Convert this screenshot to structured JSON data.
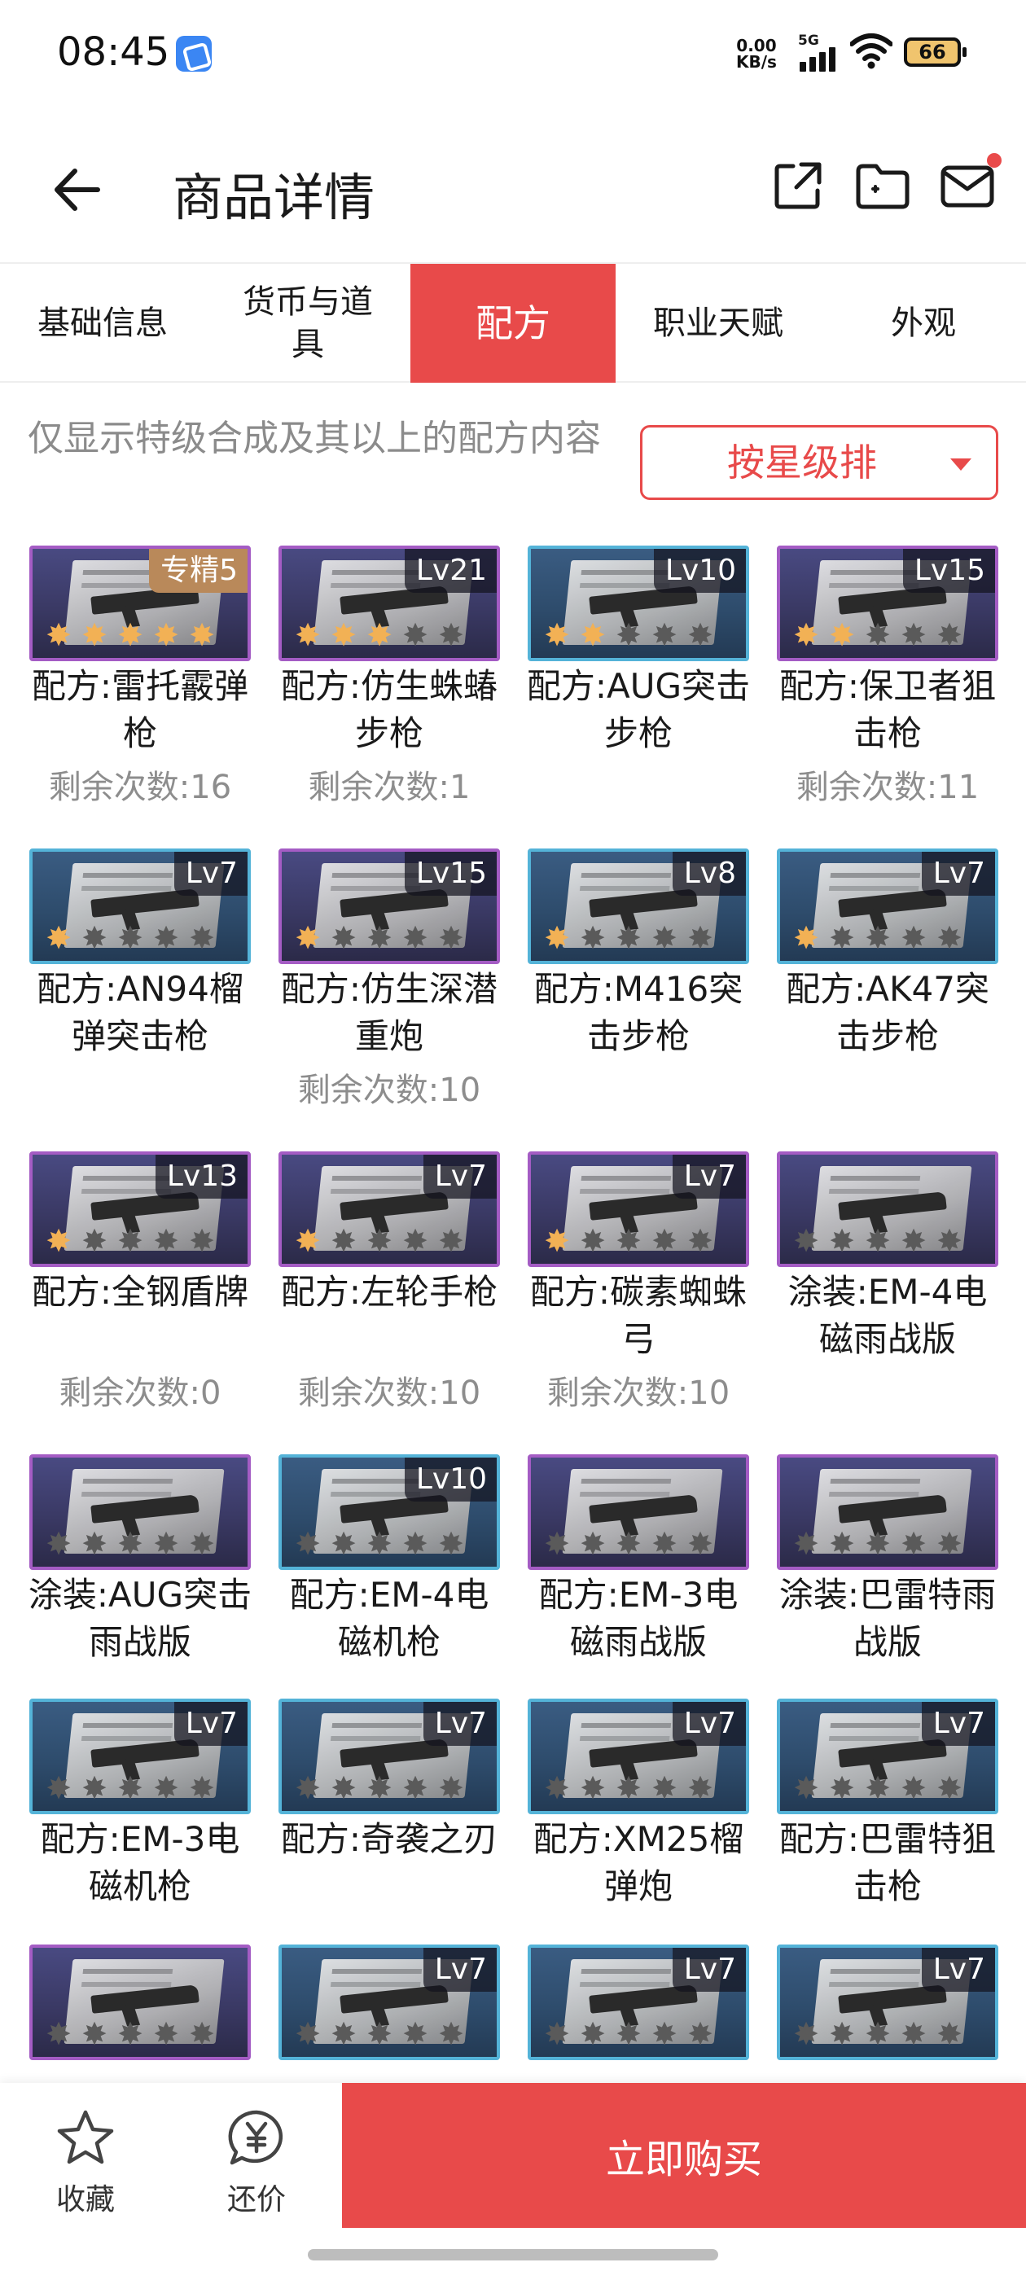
{
  "status_bar": {
    "time": "08:45",
    "net_speed_value": "0.00",
    "net_speed_unit": "KB/s",
    "network": "5G",
    "battery": "66"
  },
  "header": {
    "title": "商品详情",
    "back_icon": "arrow-left-icon",
    "icons": [
      "share-icon",
      "folder-icon",
      "mail-icon"
    ]
  },
  "tabs": [
    {
      "label": "基础信息",
      "active": false
    },
    {
      "label": "货币与道具",
      "active": false
    },
    {
      "label": "配方",
      "active": true
    },
    {
      "label": "职业天赋",
      "active": false
    },
    {
      "label": "外观",
      "active": false
    }
  ],
  "filter": {
    "notice": "仅显示特级合成及其以上的配方内容",
    "sort_label": "按星级排"
  },
  "items": [
    {
      "name": "配方:雷托霰弹枪",
      "badge": "专精5",
      "count": "剩余次数:16",
      "stars": 5,
      "frame": "purple"
    },
    {
      "name": "配方:仿生蛛蝽步枪",
      "badge": "Lv21",
      "count": "剩余次数:1",
      "stars": 3,
      "frame": "purple"
    },
    {
      "name": "配方:AUG突击步枪",
      "badge": "Lv10",
      "count": "",
      "stars": 2,
      "frame": "blue"
    },
    {
      "name": "配方:保卫者狙击枪",
      "badge": "Lv15",
      "count": "剩余次数:11",
      "stars": 2,
      "frame": "purple"
    },
    {
      "name": "配方:AN94榴弹突击枪",
      "badge": "Lv7",
      "count": "",
      "stars": 1,
      "frame": "blue"
    },
    {
      "name": "配方:仿生深潜重炮",
      "badge": "Lv15",
      "count": "剩余次数:10",
      "stars": 1,
      "frame": "purple"
    },
    {
      "name": "配方:M416突击步枪",
      "badge": "Lv8",
      "count": "",
      "stars": 1,
      "frame": "blue"
    },
    {
      "name": "配方:AK47突击步枪",
      "badge": "Lv7",
      "count": "",
      "stars": 1,
      "frame": "blue"
    },
    {
      "name": "配方:全钢盾牌",
      "badge": "Lv13",
      "count": "剩余次数:0",
      "stars": 1,
      "frame": "purple"
    },
    {
      "name": "配方:左轮手枪",
      "badge": "Lv7",
      "count": "剩余次数:10",
      "stars": 1,
      "frame": "purple"
    },
    {
      "name": "配方:碳素蜘蛛弓",
      "badge": "Lv7",
      "count": "剩余次数:10",
      "stars": 1,
      "frame": "purple"
    },
    {
      "name": "涂装:EM-4电磁雨战版",
      "badge": "",
      "count": "",
      "stars": 0,
      "frame": "purple"
    },
    {
      "name": "涂装:AUG突击雨战版",
      "badge": "",
      "count": "",
      "stars": 0,
      "frame": "purple"
    },
    {
      "name": "配方:EM-4电磁机枪",
      "badge": "Lv10",
      "count": "",
      "stars": 0,
      "frame": "blue"
    },
    {
      "name": "配方:EM-3电磁雨战版",
      "badge": "",
      "count": "",
      "stars": 0,
      "frame": "purple"
    },
    {
      "name": "涂装:巴雷特雨战版",
      "badge": "",
      "count": "",
      "stars": 0,
      "frame": "purple"
    },
    {
      "name": "配方:EM-3电磁机枪",
      "badge": "Lv7",
      "count": "",
      "stars": 0,
      "frame": "blue"
    },
    {
      "name": "配方:奇袭之刃",
      "badge": "Lv7",
      "count": "",
      "stars": 0,
      "frame": "blue"
    },
    {
      "name": "配方:XM25榴弹炮",
      "badge": "Lv7",
      "count": "",
      "stars": 0,
      "frame": "blue"
    },
    {
      "name": "配方:巴雷特狙击枪",
      "badge": "Lv7",
      "count": "",
      "stars": 0,
      "frame": "blue"
    },
    {
      "name": "",
      "badge": "",
      "count": "",
      "stars": 0,
      "frame": "purple"
    },
    {
      "name": "",
      "badge": "Lv7",
      "count": "",
      "stars": 0,
      "frame": "blue"
    },
    {
      "name": "",
      "badge": "Lv7",
      "count": "",
      "stars": 0,
      "frame": "blue"
    },
    {
      "name": "",
      "badge": "Lv7",
      "count": "",
      "stars": 0,
      "frame": "blue"
    }
  ],
  "bottom_bar": {
    "favorite_label": "收藏",
    "bargain_label": "还价",
    "buy_label": "立即购买"
  }
}
